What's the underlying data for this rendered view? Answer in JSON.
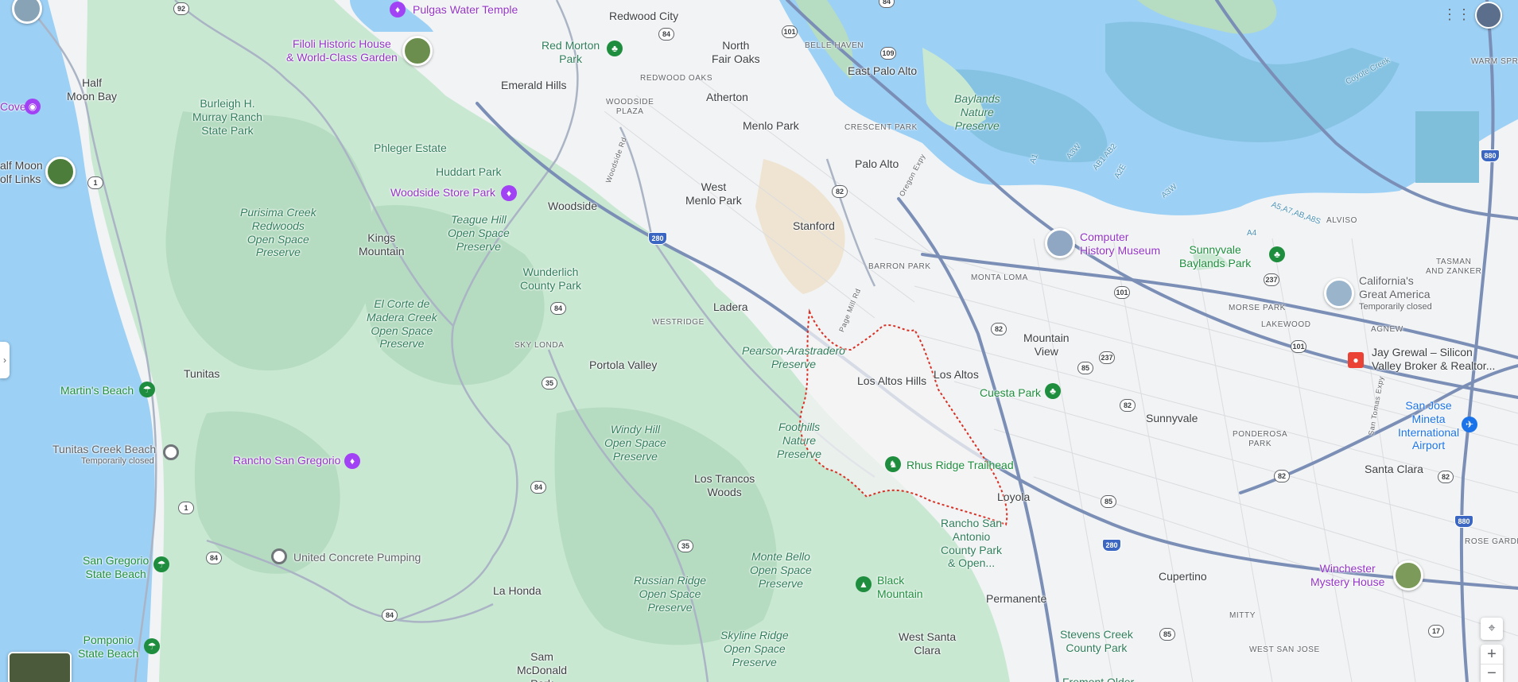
{
  "colors": {
    "water": "#9cd0f5",
    "forest": "#bfe5cc",
    "land": "#f1f3f4",
    "highway": "#7b8fb6",
    "boundary": "#d93025"
  },
  "cities": {
    "redwood_city": "Redwood City",
    "north_fair_oaks": "North\nFair Oaks",
    "east_palo_alto": "East Palo Alto",
    "atherton": "Atherton",
    "menlo_park": "Menlo Park",
    "palo_alto": "Palo Alto",
    "west_menlo_park": "West\nMenlo Park",
    "stanford": "Stanford",
    "emerald_hills": "Emerald Hills",
    "woodside": "Woodside",
    "kings_mountain": "Kings\nMountain",
    "half_moon_bay": "Half\nMoon Bay",
    "ladera": "Ladera",
    "portola_valley": "Portola Valley",
    "los_altos_hills": "Los Altos Hills",
    "los_altos": "Los Altos",
    "mountain_view": "Mountain\nView",
    "sunnyvale": "Sunnyvale",
    "santa_clara": "Santa Clara",
    "loyola": "Loyola",
    "cupertino": "Cupertino",
    "permanente": "Permanente",
    "west_santa_clara": "West Santa\nClara",
    "los_trancos_woods": "Los Trancos\nWoods",
    "la_honda": "La Honda",
    "tunitas": "Tunitas",
    "sam_mcdonald": "Sam\nMcDonald\nPark"
  },
  "neighborhoods": {
    "belle_haven": "BELLE HAVEN",
    "redwood_oaks": "REDWOOD OAKS",
    "woodside_plaza": "WOODSIDE\nPLAZA",
    "crescent_park": "CRESCENT PARK",
    "barron_park": "BARRON PARK",
    "monta_loma": "MONTA LOMA",
    "westridge": "WESTRIDGE",
    "sky_londa": "SKY LONDA",
    "morse_park": "MORSE PARK",
    "lakewood": "LAKEWOOD",
    "agnew": "AGNEW",
    "alviso": "ALVISO",
    "tasman": "TASMAN\nAND ZANKER",
    "ponderosa_park": "PONDEROSA\nPARK",
    "warm_springs": "WARM SPRI",
    "rose_garden": "ROSE GARDEN",
    "mitty": "MITTY",
    "west_san_jose": "WEST SAN JOSE"
  },
  "parks": {
    "red_morton": "Red Morton\nPark",
    "burleigh": "Burleigh H.\nMurray Ranch\nState Park",
    "phleger": "Phleger Estate",
    "huddart": "Huddart Park",
    "purisima": "Purisima Creek\nRedwoods\nOpen Space\nPreserve",
    "teague": "Teague Hill\nOpen Space\nPreserve",
    "wunderlich": "Wunderlich\nCounty Park",
    "el_corte": "El Corte de\nMadera Creek\nOpen Space\nPreserve",
    "pearson": "Pearson-Arastradero\nPreserve",
    "foothills": "Foothills\nNature\nPreserve",
    "windy_hill": "Windy Hill\nOpen Space\nPreserve",
    "russian_ridge": "Russian Ridge\nOpen Space\nPreserve",
    "monte_bello": "Monte Bello\nOpen Space\nPreserve",
    "skyline_ridge": "Skyline Ridge\nOpen Space\nPreserve",
    "baylands": "Baylands\nNature\nPreserve",
    "stevens_creek": "Stevens Creek\nCounty Park",
    "rancho_san_antonio": "Rancho San\nAntonio\nCounty Park\n& Open...",
    "fremont_older": "Fremont Older"
  },
  "pois": {
    "pulgas": "Pulgas Water Temple",
    "filoli": "Filoli Historic House\n& World-Class Garden",
    "woodside_store": "Woodside Store Park",
    "rancho_san_gregorio": "Rancho San Gregorio",
    "martins_beach": "Martin's Beach",
    "tunitas_beach": "Tunitas Creek Beach",
    "tunitas_closed": "Temporarily closed",
    "united_concrete": "United Concrete Pumping",
    "san_gregorio_beach": "San Gregorio\nState Beach",
    "pomponio": "Pomponio\nState Beach",
    "cuesta_park": "Cuesta Park",
    "rhus_ridge": "Rhus Ridge Trailhead",
    "black_mountain": "Black\nMountain",
    "computer_history": "Computer\nHistory Museum",
    "sunnyvale_baylands": "Sunnyvale\nBaylands Park",
    "californias_great_america": "California's\nGreat America",
    "cga_closed": "Temporarily closed",
    "jay_grewal": "Jay Grewal – Silicon\nValley Broker & Realtor...",
    "sjc_airport": "San Jose\nMineta\nInternational\nAirport",
    "winchester": "Winchester\nMystery House",
    "cove": "Cove",
    "half_moon_bay_links": "alf Moon\nolf Links"
  },
  "water_labels": {
    "a1": "A1",
    "a3w": "A3W",
    "ab1ab2": "AB1 AB2",
    "a2e": "A2E",
    "a3w2": "A3W",
    "a4": "A4",
    "a5a7": "A5,A7,AB,A8S",
    "coyote": "Coyote Creek"
  },
  "roads": {
    "woodside_rd": "Woodside Rd",
    "oregon_expy": "Oregon Expy",
    "page_mill": "Page Mill Rd",
    "san_tomas": "San Tomas Expy"
  },
  "shields": {
    "r92": "92",
    "r84a": "84",
    "r84b": "84",
    "r84c": "84",
    "r84d": "84",
    "r84e": "84",
    "r101a": "101",
    "r101b": "101",
    "r101c": "101",
    "r109": "109",
    "r1a": "1",
    "r1b": "1",
    "r280a": "280",
    "r280b": "280",
    "r82a": "82",
    "r82b": "82",
    "r82c": "82",
    "r82d": "82",
    "r82e": "82",
    "r35a": "35",
    "r35b": "35",
    "r237a": "237",
    "r237b": "237",
    "r85a": "85",
    "r85b": "85",
    "r85c": "85",
    "r880a": "880",
    "r880b": "880",
    "r17": "17"
  },
  "controls": {
    "apps_icon": "apps-grid-icon",
    "locate": "my-location-icon",
    "zoom_in": "+",
    "zoom_out": "−",
    "expand": "chevron-right-icon",
    "layers": "satellite-layer-icon"
  }
}
